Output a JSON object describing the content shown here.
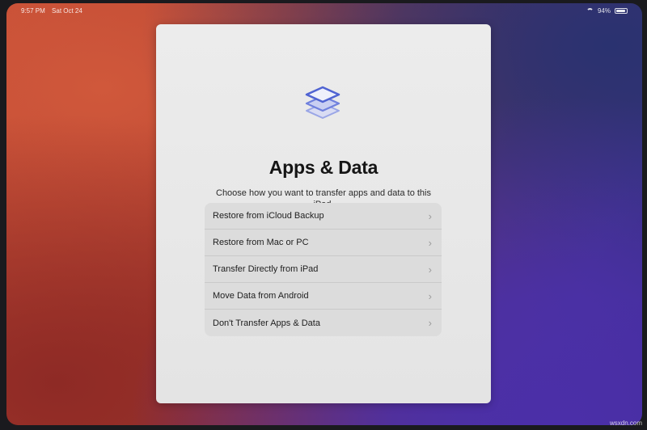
{
  "status_bar": {
    "time": "9:57 PM",
    "date": "Sat Oct 24",
    "battery": "94%",
    "battery_level": 0.94
  },
  "sheet": {
    "icon": "stacked-layers-icon",
    "title": "Apps & Data",
    "subtitle": "Choose how you want to transfer apps and data to this iPad."
  },
  "options": [
    {
      "label": "Restore from iCloud Backup",
      "icon": "chevron-right-icon"
    },
    {
      "label": "Restore from Mac or PC",
      "icon": "chevron-right-icon"
    },
    {
      "label": "Transfer Directly from iPad",
      "icon": "chevron-right-icon"
    },
    {
      "label": "Move Data from Android",
      "icon": "chevron-right-icon"
    },
    {
      "label": "Don't Transfer Apps & Data",
      "icon": "chevron-right-icon"
    }
  ],
  "watermark": "wsxdn.com",
  "colors": {
    "accent_icon": "#5b6fd6",
    "sheet_bg": "#e8e8e8",
    "list_bg": "#dcdcdc"
  }
}
